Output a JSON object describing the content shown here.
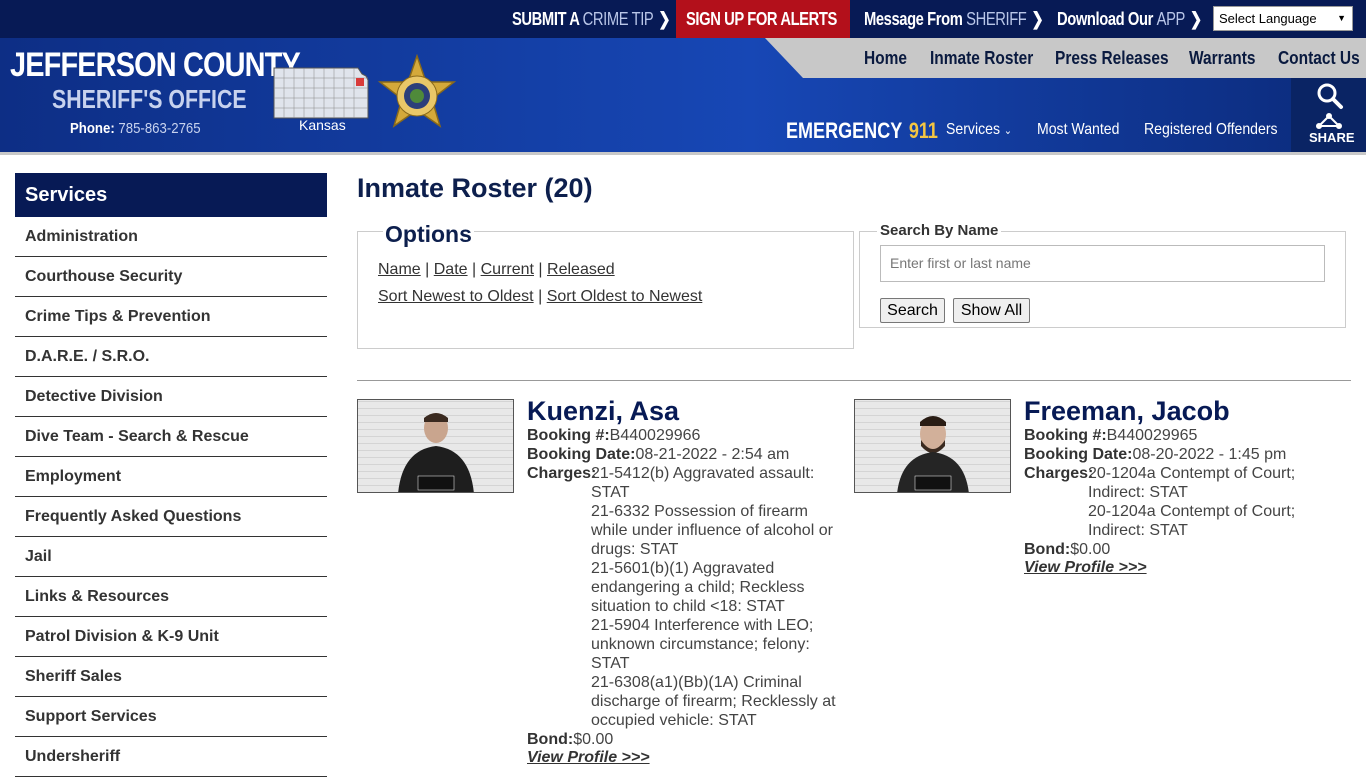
{
  "topbar": {
    "tip_bold": "SUBMIT A",
    "tip_lite": "CRIME TIP",
    "alerts": "SIGN UP FOR ALERTS",
    "message_bold": "Message From",
    "message_lite": "SHERIFF",
    "app_bold": "Download Our",
    "app_lite": "APP",
    "language": "Select Language",
    "chevron": "❯"
  },
  "header": {
    "title": "JEFFERSON COUNTY",
    "subtitle": "SHERIFF'S OFFICE",
    "phone_label": "Phone:",
    "phone_number": "785-863-2765",
    "state_label": "Kansas",
    "emergency_label": "EMERGENCY",
    "emergency_number": "911",
    "share_label": "SHARE"
  },
  "nav": {
    "main": [
      "Home",
      "Inmate Roster",
      "Press Releases",
      "Warrants",
      "Contact Us"
    ],
    "services": "Services",
    "most_wanted": "Most Wanted",
    "registered_offenders": "Registered Offenders"
  },
  "sidebar": {
    "title": "Services",
    "items": [
      "Administration",
      "Courthouse Security",
      "Crime Tips & Prevention",
      "D.A.R.E. / S.R.O.",
      "Detective Division",
      "Dive Team - Search & Rescue",
      "Employment",
      "Frequently Asked Questions",
      "Jail",
      "Links & Resources",
      "Patrol Division & K-9 Unit",
      "Sheriff Sales",
      "Support Services",
      "Undersheriff"
    ]
  },
  "main": {
    "title": "Inmate Roster (20)",
    "options_title": "Options",
    "sort_links_1": [
      "Name",
      "Date",
      "Current",
      "Released"
    ],
    "sort_links_2": [
      "Sort Newest to Oldest",
      "Sort Oldest to Newest"
    ],
    "separator": "|",
    "search_legend": "Search By Name",
    "search_placeholder": "Enter first or last name",
    "search_button": "Search",
    "show_all_button": "Show All"
  },
  "labels": {
    "booking_no": "Booking #:",
    "booking_date": "Booking Date:",
    "charges": "Charges:",
    "bond": "Bond:",
    "view_profile": "View Profile >>>"
  },
  "inmates": [
    {
      "name": "Kuenzi, Asa",
      "booking_no": "B440029966",
      "booking_date": "08-21-2022 - 2:54 am",
      "charges": [
        "21-5412(b) Aggravated assault:",
        "STAT",
        "21-6332 Possession of firearm",
        "while under influence of alcohol or",
        "drugs: STAT",
        "21-5601(b)(1) Aggravated",
        "endangering a child; Reckless",
        "situation to child <18: STAT",
        "21-5904 Interference with LEO;",
        "unknown circumstance; felony:",
        "STAT",
        "21-6308(a1)(Bb)(1A) Criminal",
        "discharge of firearm; Recklessly at",
        "occupied vehicle: STAT"
      ],
      "bond": "$0.00"
    },
    {
      "name": "Freeman, Jacob",
      "booking_no": "B440029965",
      "booking_date": "08-20-2022 - 1:45 pm",
      "charges": [
        "20-1204a Contempt of Court;",
        "Indirect: STAT",
        "20-1204a Contempt of Court;",
        "Indirect: STAT"
      ],
      "bond": "$0.00"
    }
  ],
  "colors": {
    "navy": "#071a55",
    "header_blue": "#1747b5",
    "alert_red": "#b3101b",
    "gold": "#f4c542"
  }
}
